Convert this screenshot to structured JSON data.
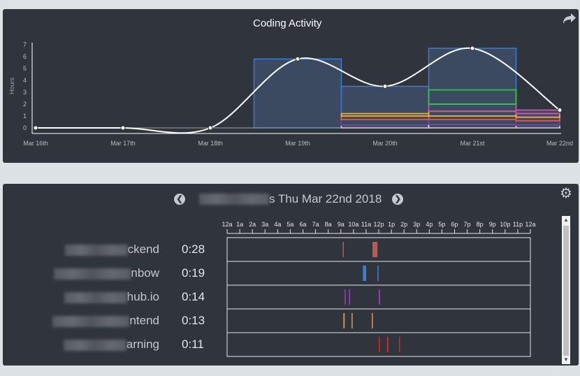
{
  "activity": {
    "title": "Coding Activity",
    "share_icon": "share-icon",
    "chart_data": {
      "type": "area",
      "ylabel": "Hours",
      "xlabel": "",
      "categories": [
        "Mar 16th",
        "Mar 17th",
        "Mar 18th",
        "Mar 19th",
        "Mar 20th",
        "Mar 21st",
        "Mar 22nd"
      ],
      "ylim": [
        0,
        7
      ],
      "yticks": [
        "0",
        "1",
        "2",
        "3",
        "4",
        "5",
        "6",
        "7"
      ],
      "total_line": [
        0,
        0,
        0,
        5.8,
        3.5,
        6.7,
        1.5
      ],
      "colors": {
        "line": "#ffffff",
        "total_box": "#3a7bd5",
        "fill": "#3b4a60",
        "stack": [
          "#dddddd",
          "#7a3a9a",
          "#e05555",
          "#f0b030",
          "#d14fa8",
          "#35c44a"
        ]
      },
      "stacks": [
        {
          "category": "Mar 20th",
          "values": [
            0.2,
            0.5,
            0.3,
            0.2
          ]
        },
        {
          "category": "Mar 21st",
          "values": [
            0.3,
            0.4,
            0.3,
            0.4,
            0.6,
            1.2
          ]
        },
        {
          "category": "Mar 22nd",
          "values": [
            0.2,
            0.4,
            0.3,
            0.3,
            0.3
          ]
        }
      ],
      "grid": false
    }
  },
  "day": {
    "settings_icon": "gear-icon",
    "prev_icon": "chevron-left-icon",
    "next_icon": "chevron-right-icon",
    "date_label": "s Thu Mar 22nd 2018",
    "hours": [
      "12a",
      "1a",
      "2a",
      "3a",
      "4a",
      "5a",
      "6a",
      "7a",
      "8a",
      "9a",
      "10a",
      "11a",
      "12p",
      "1p",
      "2p",
      "3p",
      "4p",
      "5p",
      "6p",
      "7p",
      "8p",
      "9p",
      "10p",
      "11p",
      "12a"
    ],
    "projects": [
      {
        "name": "ckend",
        "time": "0:28",
        "color": "#b85a4e",
        "marks": [
          [
            9.15,
            0.05
          ],
          [
            11.5,
            0.4
          ]
        ]
      },
      {
        "name": "nbow",
        "time": "0:19",
        "color": "#3b82d6",
        "marks": [
          [
            10.75,
            0.25
          ],
          [
            11.9,
            0.05
          ]
        ]
      },
      {
        "name": "hub.io",
        "time": "0:14",
        "color": "#9b3fc0",
        "marks": [
          [
            9.3,
            0.08
          ],
          [
            9.65,
            0.06
          ],
          [
            12.0,
            0.1
          ]
        ]
      },
      {
        "name": "ntend",
        "time": "0:13",
        "color": "#e09a55",
        "marks": [
          [
            9.2,
            0.1
          ],
          [
            9.85,
            0.08
          ],
          [
            11.45,
            0.03
          ]
        ]
      },
      {
        "name": "arning",
        "time": "0:11",
        "color": "#d9242c",
        "marks": [
          [
            12.0,
            0.05
          ],
          [
            12.65,
            0.12
          ],
          [
            13.6,
            0.04
          ]
        ]
      }
    ]
  }
}
